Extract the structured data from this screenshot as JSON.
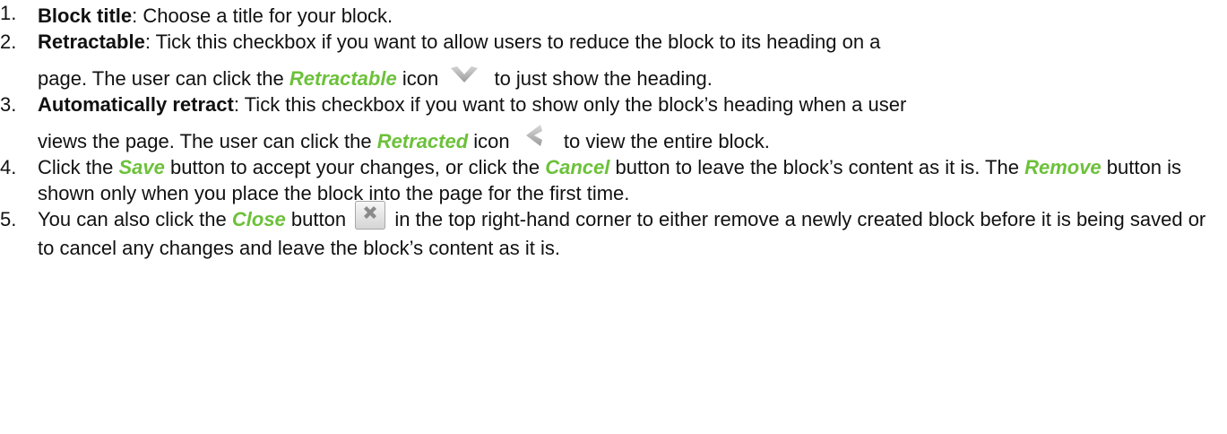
{
  "steps": [
    {
      "num": "1.",
      "term": "Block title",
      "text": ": Choose a title for your block."
    },
    {
      "num": "2.",
      "term": "Retractable",
      "text": ": Tick this checkbox if you want to allow users to reduce the block to its heading on a",
      "line2_pre": "page. The user can click the ",
      "ui": "Retractable",
      "line2_mid": " icon",
      "line2_post": "to just show the heading.",
      "icon": "chevron-down-icon"
    },
    {
      "num": "3.",
      "term": "Automatically retract",
      "text": ": Tick this checkbox if you want to show only the block’s heading when a user",
      "line2_pre": "views the page. The user can click the ",
      "ui": "Retracted",
      "line2_mid": " icon",
      "line2_post": "to view the entire block.",
      "icon": "chevron-left-icon"
    },
    {
      "num": "4.",
      "pre": "Click the ",
      "ui1": "Save",
      "mid1": " button to accept your changes, or click the ",
      "ui2": "Cancel",
      "mid2": " button to leave the block’s content as it is. The ",
      "ui3": "Remove",
      "post": " button is shown only when you place the block into the page for the first time."
    },
    {
      "num": "5.",
      "pre": "You can also click the ",
      "ui": "Close",
      "mid": " button",
      "post": " in the top right-hand corner to either remove a newly created block before it is being saved or to cancel any changes and leave the block’s content as it is.",
      "icon": "close-button-icon"
    }
  ],
  "colors": {
    "ui_label": "#6cc13a",
    "text": "#111111"
  }
}
